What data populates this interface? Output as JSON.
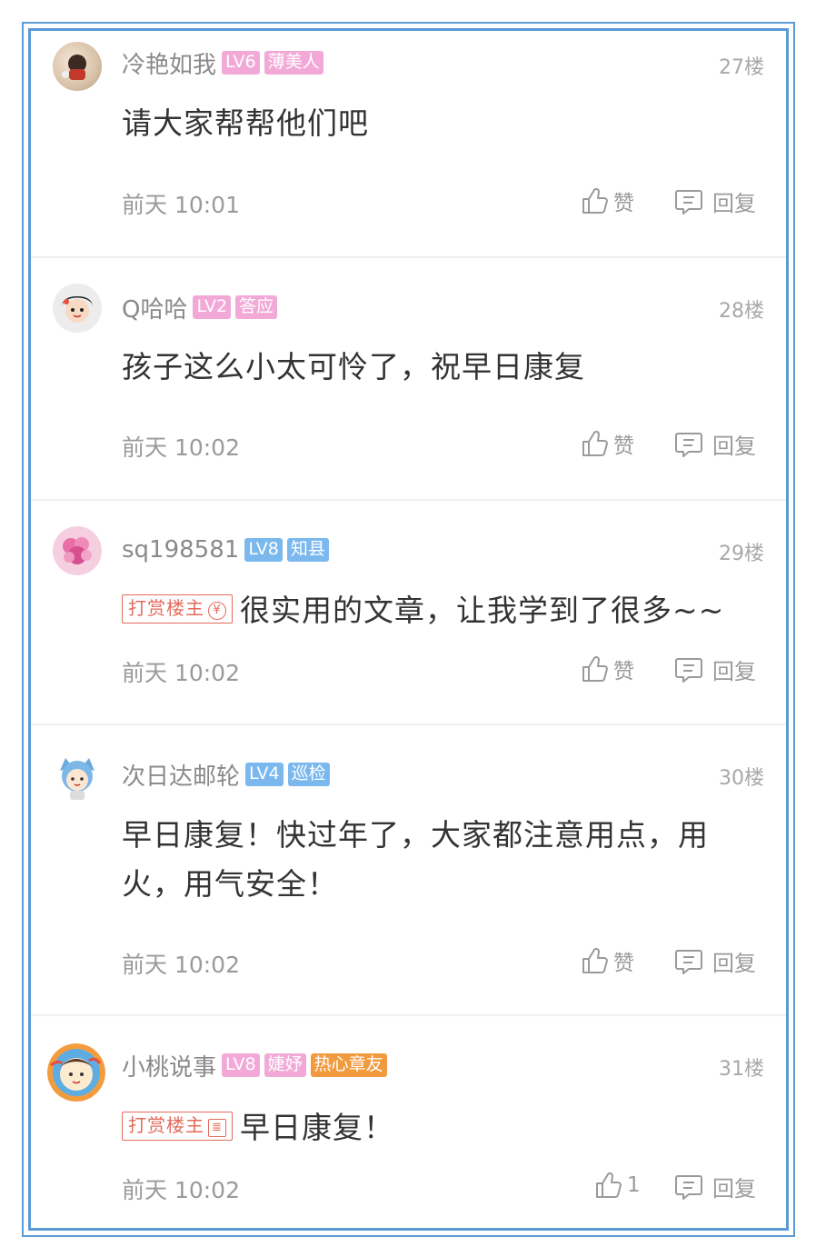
{
  "comments": [
    {
      "username": "冷艳如我",
      "badges": [
        {
          "text": "LV6",
          "color": "pink"
        },
        {
          "text": "薄美人",
          "color": "pink"
        }
      ],
      "floor": "27楼",
      "reward_tag": null,
      "content": "请大家帮帮他们吧",
      "time": "前天 10:01",
      "like_label": "赞",
      "reply_label": "回复"
    },
    {
      "username": "Q哈哈",
      "badges": [
        {
          "text": "LV2",
          "color": "pink"
        },
        {
          "text": "答应",
          "color": "pink"
        }
      ],
      "floor": "28楼",
      "reward_tag": null,
      "content": "孩子这么小太可怜了，祝早日康复",
      "time": "前天 10:02",
      "like_label": "赞",
      "reply_label": "回复"
    },
    {
      "username": "sq198581",
      "badges": [
        {
          "text": "LV8",
          "color": "blue"
        },
        {
          "text": "知县",
          "color": "blue"
        }
      ],
      "floor": "29楼",
      "reward_tag": "打赏楼主",
      "content": "很实用的文章，让我学到了很多~~",
      "time": "前天 10:02",
      "like_label": "赞",
      "reply_label": "回复"
    },
    {
      "username": "次日达邮轮",
      "badges": [
        {
          "text": "LV4",
          "color": "blue"
        },
        {
          "text": "巡检",
          "color": "blue"
        }
      ],
      "floor": "30楼",
      "reward_tag": null,
      "content": "早日康复！快过年了，大家都注意用点，用火，用气安全！",
      "time": "前天 10:02",
      "like_label": "赞",
      "reply_label": "回复"
    },
    {
      "username": "小桃说事",
      "badges": [
        {
          "text": "LV8",
          "color": "pink"
        },
        {
          "text": "婕妤",
          "color": "pink"
        },
        {
          "text": "热心章友",
          "color": "orange"
        }
      ],
      "floor": "31楼",
      "reward_tag": "打赏楼主",
      "content": "早日康复！",
      "time": "前天 10:02",
      "like_label": "1",
      "reply_label": "回复"
    }
  ],
  "icons": {
    "like": "thumbs-up-icon",
    "reply": "comment-bubble-icon",
    "reward_coin": "coin-icon"
  },
  "colors": {
    "frame_border": "#5b9bd5",
    "badge_pink": "#f3a9d8",
    "badge_blue": "#7ab8ee",
    "badge_orange": "#f19a3e",
    "reward_red": "#e46a5a"
  }
}
